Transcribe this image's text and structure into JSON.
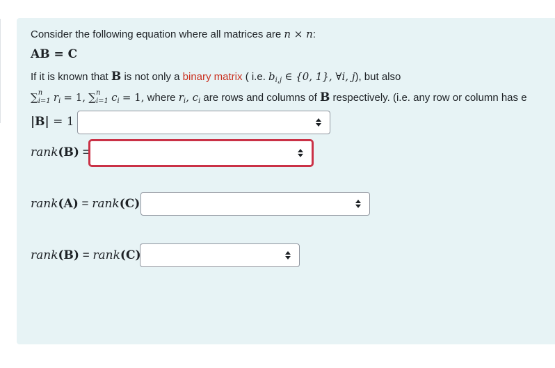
{
  "question": {
    "intro": "Consider the following equation where all matrices are",
    "intro_math": "n × n",
    "intro_end": ":",
    "equation": "AB = C",
    "cond1_start": "If it is known that",
    "cond1_B": "B",
    "cond1_mid": "is not only a",
    "cond1_link": "binary matrix",
    "cond1_ie": "( i.e.",
    "cond1_math": "b",
    "cond1_sub": "i,j",
    "cond1_math2": "∈ {0, 1},   ∀i, j",
    "cond1_end": "), but also",
    "cond2_sum1": "r",
    "cond2_sum1_sub": "i",
    "cond2_eq1": "= 1,",
    "cond2_sum2": "c",
    "cond2_sum2_sub": "i",
    "cond2_eq2": "= 1,",
    "sum_sym": "∑",
    "sum_sup": "n",
    "sum_sub": "i=1",
    "cond2_where": "where",
    "cond2_vars": "r",
    "cond2_vars_sub": "i",
    "cond2_vars2": ", c",
    "cond2_vars2_sub": "i",
    "cond2_tail": "are rows and columns of",
    "cond2_B": "B",
    "cond2_end": "respectively. (i.e. any row or column has e"
  },
  "fields": {
    "det_label_bars": "|B|",
    "det_label_eq": "= 1",
    "rankB_label": "rank",
    "rankB_arg": "(B)",
    "rankB_eq": "=",
    "rankA_label": "rank",
    "rankA_arg": "(A)",
    "rankA_eq": "=",
    "rankA_rhs": "rank",
    "rankA_rhs_arg": "(C)",
    "rankBC_label": "rank",
    "rankBC_arg": "(B)",
    "rankBC_eq": "=",
    "rankBC_rhs": "rank",
    "rankBC_rhs_arg": "(C)"
  },
  "colors": {
    "link": "#ca3120",
    "error_border": "#ca3146",
    "panel_bg": "#e7f3f5"
  }
}
